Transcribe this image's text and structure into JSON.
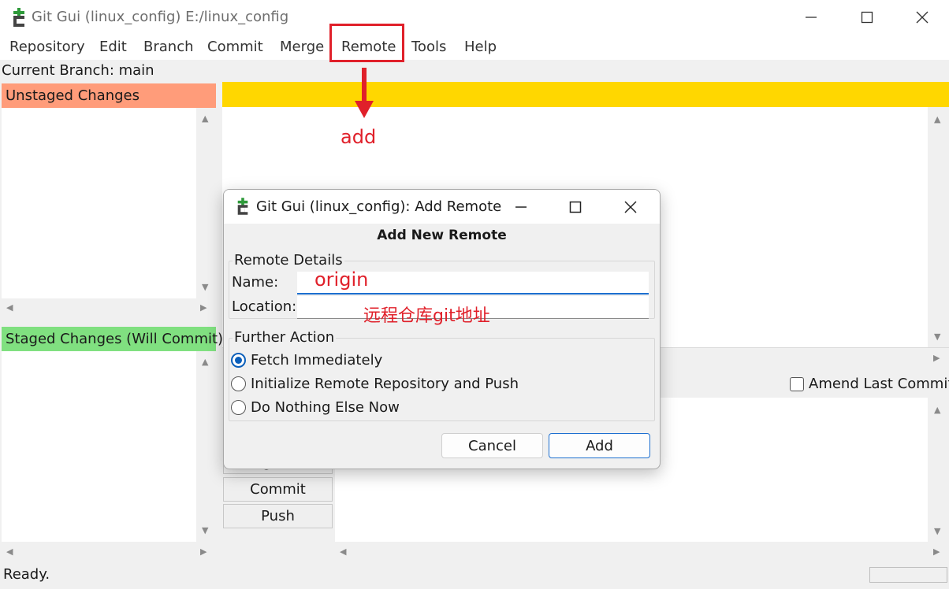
{
  "window": {
    "title": "Git Gui (linux_config) E:/linux_config",
    "menu": [
      "Repository",
      "Edit",
      "Branch",
      "Commit",
      "Merge",
      "Remote",
      "Tools",
      "Help"
    ]
  },
  "branch": {
    "label": "Current Branch: main"
  },
  "panes": {
    "unstaged": "Unstaged Changes",
    "staged": "Staged Changes (Will Commit)",
    "unstaged_color": "#ff9c7a",
    "staged_color": "#80e080",
    "diff_header_color": "#ffd700"
  },
  "commit_area": {
    "amend_label": "Amend Last Commit",
    "buttons": {
      "signoff": "Sign Off",
      "commit": "Commit",
      "push": "Push"
    }
  },
  "status": {
    "text": "Ready."
  },
  "dialog": {
    "title": "Git Gui (linux_config): Add Remote",
    "heading": "Add New Remote",
    "details_legend": "Remote Details",
    "name_label": "Name:",
    "location_label": "Location:",
    "further_legend": "Further Action",
    "options": [
      "Fetch Immediately",
      "Initialize Remote Repository and Push",
      "Do Nothing Else Now"
    ],
    "selected_option": "Fetch Immediately",
    "cancel": "Cancel",
    "add": "Add"
  },
  "annotations": {
    "add_text": "add",
    "name_value": "origin",
    "location_hint": "远程仓库git地址",
    "color": "#e0202a"
  }
}
